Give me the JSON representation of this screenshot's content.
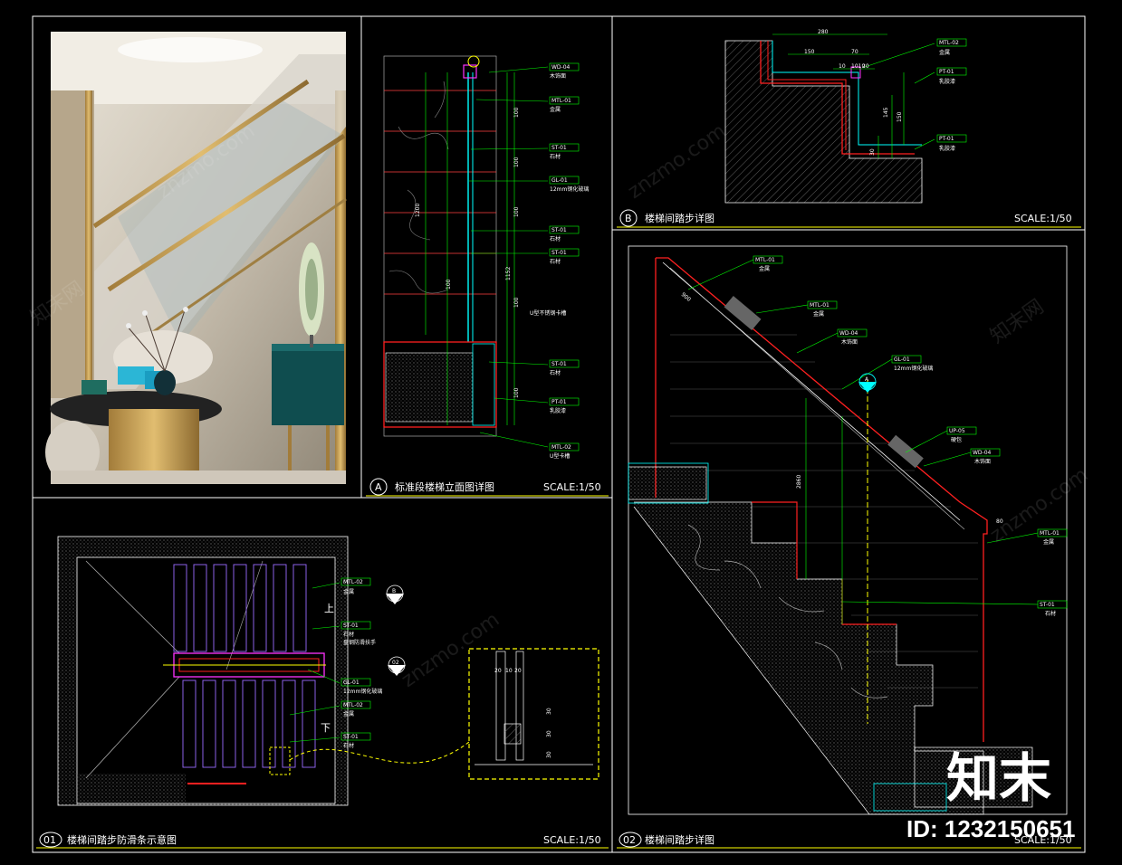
{
  "panels": {
    "A": {
      "letter": "A",
      "title": "标准段楼梯立面图详图",
      "scale": "SCALE:1/50",
      "tags": [
        {
          "code": "WD-04",
          "desc": "木饰面"
        },
        {
          "code": "MTL-01",
          "desc": "金属"
        },
        {
          "code": "ST-01",
          "desc": "石材"
        },
        {
          "code": "GL-01",
          "desc": "12mm钢化玻璃"
        },
        {
          "code": "ST-01",
          "desc": "石材"
        },
        {
          "code": "ST-01",
          "desc": "石材"
        },
        {
          "code": "ST-01",
          "desc": "石材"
        },
        {
          "code": "PT-01",
          "desc": "乳胶漆"
        },
        {
          "code": "MTL-02",
          "desc": "U型卡槽"
        }
      ],
      "note": "U型不锈钢卡槽",
      "dims": [
        "1200",
        "100",
        "1152",
        "100",
        "100",
        "100",
        "100",
        "100"
      ]
    },
    "B": {
      "letter": "B",
      "title": "楼梯间踏步详图",
      "scale": "SCALE:1/50",
      "tags": [
        {
          "code": "MTL-02",
          "desc": "金属"
        },
        {
          "code": "PT-01",
          "desc": "乳胶漆"
        },
        {
          "code": "PT-01",
          "desc": "乳胶漆"
        }
      ],
      "dims": [
        "280",
        "150",
        "70",
        "20",
        "10",
        "1010",
        "145",
        "150",
        "30"
      ]
    },
    "p01": {
      "letter": "01",
      "title": "楼梯间踏步防滑条示意图",
      "scale": "SCALE:1/50",
      "tags": [
        {
          "code": "MTL-02",
          "desc": "金属"
        },
        {
          "code": "ST-01",
          "desc": "石材"
        },
        {
          "code": "GL-01",
          "desc": "12mm钢化玻璃"
        },
        {
          "code": "MTL-02",
          "desc": "金属"
        },
        {
          "code": "ST-01",
          "desc": "石材"
        }
      ],
      "extra": "盘钢防滑扶手",
      "up": "上",
      "down": "下",
      "callouts": [
        "B",
        "02"
      ],
      "detail_dims": [
        "20",
        "10",
        "20",
        "30",
        "30",
        "30"
      ]
    },
    "p02": {
      "letter": "02",
      "title": "楼梯间踏步详图",
      "scale": "SCALE:1/50",
      "tags": [
        {
          "code": "MTL-01",
          "desc": "金属"
        },
        {
          "code": "MTL-01",
          "desc": "金属"
        },
        {
          "code": "WD-04",
          "desc": "木饰面"
        },
        {
          "code": "GL-01",
          "desc": "12mm钢化玻璃"
        },
        {
          "code": "UP-05",
          "desc": "硬包"
        },
        {
          "code": "WD-04",
          "desc": "木饰面"
        },
        {
          "code": "MTL-01",
          "desc": "金属"
        },
        {
          "code": "ST-01",
          "desc": "石材"
        }
      ],
      "callout": "A",
      "dims": [
        "900",
        "2860",
        "80"
      ]
    }
  },
  "watermark": "znzmo.com",
  "watermark_cn": "知末网",
  "brand": "知末",
  "image_id": "ID: 1232150651",
  "colors": {
    "frame": "#ffffff",
    "tag": "#00ff00",
    "cyan": "#00ffff",
    "red": "#ff2020",
    "purple": "#9a6bff",
    "magenta": "#ff33ff",
    "yellow": "#ffff00",
    "title_line": "#ffff00"
  }
}
